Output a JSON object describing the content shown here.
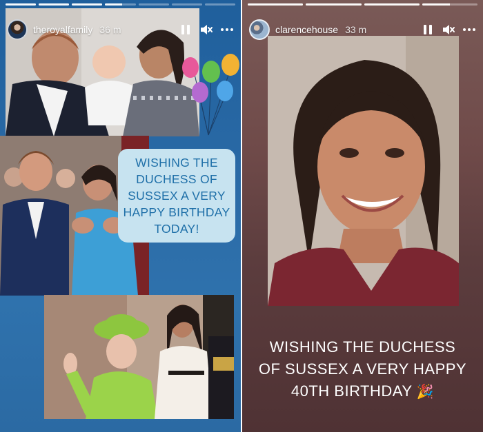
{
  "stories": {
    "left": {
      "progress": [
        1,
        1,
        1,
        0.55,
        0,
        0,
        0
      ],
      "username": "theroyalfamily",
      "timestamp": "36 m",
      "message": "WISHING THE\nDUCHESS OF\nSUSSEX A VERY\nHAPPY BIRTHDAY\nTODAY!",
      "background_color": "#2a6aa6",
      "bubble_color": "#c7e3f0",
      "bubble_text_color": "#1e6fa8"
    },
    "right": {
      "progress": [
        1,
        1,
        1,
        0.5
      ],
      "username": "clarencehouse",
      "timestamp": "33 m",
      "message": "WISHING THE DUCHESS\nOF SUSSEX A VERY HAPPY\n40TH BIRTHDAY",
      "emoji": "🎉",
      "background_color": "#6f4a49"
    }
  },
  "icons": [
    "pause-icon",
    "mute-icon",
    "more-icon"
  ],
  "balloon_colors": [
    "#e8599a",
    "#63c04e",
    "#f2b233",
    "#b46ad0",
    "#4fa6e8"
  ]
}
